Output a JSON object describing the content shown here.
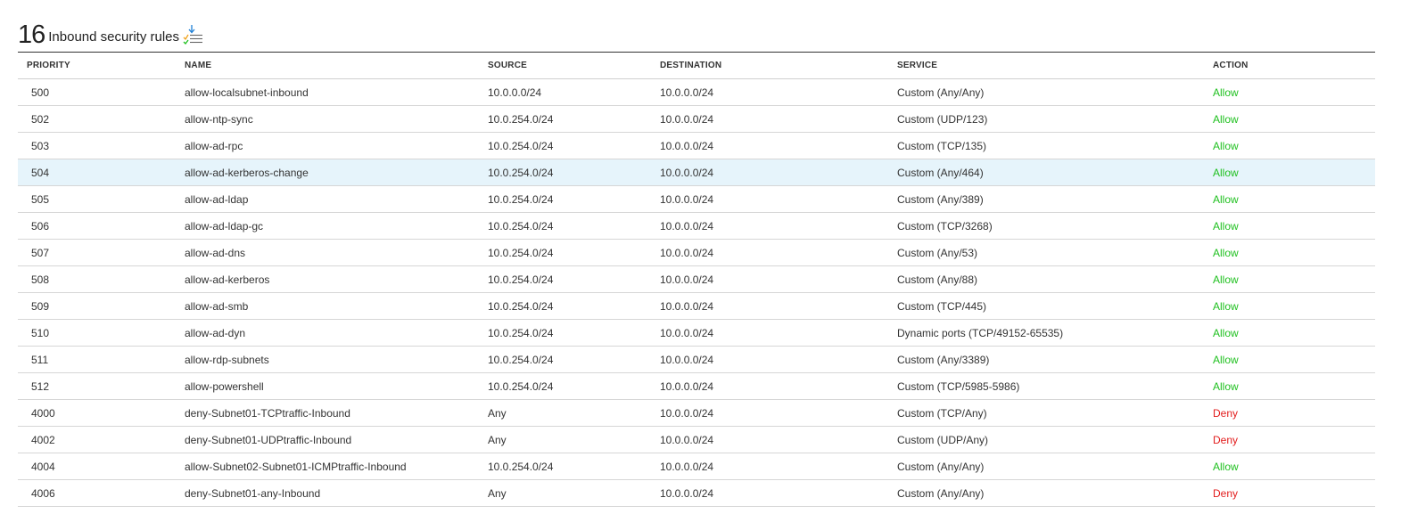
{
  "header": {
    "count": "16",
    "title": "Inbound security rules"
  },
  "columns": {
    "priority": "PRIORITY",
    "name": "NAME",
    "source": "SOURCE",
    "destination": "DESTINATION",
    "service": "SERVICE",
    "action": "ACTION"
  },
  "colors": {
    "allow": "#1fc01f",
    "deny": "#e21d1d",
    "selected_row": "#e6f4fb"
  },
  "icons": {
    "export": "download-checklist-icon"
  },
  "selected_row_index": 3,
  "rows": [
    {
      "priority": "500",
      "name": "allow-localsubnet-inbound",
      "source": "10.0.0.0/24",
      "destination": "10.0.0.0/24",
      "service": "Custom (Any/Any)",
      "action": "Allow"
    },
    {
      "priority": "502",
      "name": "allow-ntp-sync",
      "source": "10.0.254.0/24",
      "destination": "10.0.0.0/24",
      "service": "Custom (UDP/123)",
      "action": "Allow"
    },
    {
      "priority": "503",
      "name": "allow-ad-rpc",
      "source": "10.0.254.0/24",
      "destination": "10.0.0.0/24",
      "service": "Custom (TCP/135)",
      "action": "Allow"
    },
    {
      "priority": "504",
      "name": "allow-ad-kerberos-change",
      "source": "10.0.254.0/24",
      "destination": "10.0.0.0/24",
      "service": "Custom (Any/464)",
      "action": "Allow"
    },
    {
      "priority": "505",
      "name": "allow-ad-ldap",
      "source": "10.0.254.0/24",
      "destination": "10.0.0.0/24",
      "service": "Custom (Any/389)",
      "action": "Allow"
    },
    {
      "priority": "506",
      "name": "allow-ad-ldap-gc",
      "source": "10.0.254.0/24",
      "destination": "10.0.0.0/24",
      "service": "Custom (TCP/3268)",
      "action": "Allow"
    },
    {
      "priority": "507",
      "name": "allow-ad-dns",
      "source": "10.0.254.0/24",
      "destination": "10.0.0.0/24",
      "service": "Custom (Any/53)",
      "action": "Allow"
    },
    {
      "priority": "508",
      "name": "allow-ad-kerberos",
      "source": "10.0.254.0/24",
      "destination": "10.0.0.0/24",
      "service": "Custom (Any/88)",
      "action": "Allow"
    },
    {
      "priority": "509",
      "name": "allow-ad-smb",
      "source": "10.0.254.0/24",
      "destination": "10.0.0.0/24",
      "service": "Custom (TCP/445)",
      "action": "Allow"
    },
    {
      "priority": "510",
      "name": "allow-ad-dyn",
      "source": "10.0.254.0/24",
      "destination": "10.0.0.0/24",
      "service": "Dynamic ports (TCP/49152-65535)",
      "action": "Allow"
    },
    {
      "priority": "511",
      "name": "allow-rdp-subnets",
      "source": "10.0.254.0/24",
      "destination": "10.0.0.0/24",
      "service": "Custom (Any/3389)",
      "action": "Allow"
    },
    {
      "priority": "512",
      "name": "allow-powershell",
      "source": "10.0.254.0/24",
      "destination": "10.0.0.0/24",
      "service": "Custom (TCP/5985-5986)",
      "action": "Allow"
    },
    {
      "priority": "4000",
      "name": "deny-Subnet01-TCPtraffic-Inbound",
      "source": "Any",
      "destination": "10.0.0.0/24",
      "service": "Custom (TCP/Any)",
      "action": "Deny"
    },
    {
      "priority": "4002",
      "name": "deny-Subnet01-UDPtraffic-Inbound",
      "source": "Any",
      "destination": "10.0.0.0/24",
      "service": "Custom (UDP/Any)",
      "action": "Deny"
    },
    {
      "priority": "4004",
      "name": "allow-Subnet02-Subnet01-ICMPtraffic-Inbound",
      "source": "10.0.254.0/24",
      "destination": "10.0.0.0/24",
      "service": "Custom (Any/Any)",
      "action": "Allow"
    },
    {
      "priority": "4006",
      "name": "deny-Subnet01-any-Inbound",
      "source": "Any",
      "destination": "10.0.0.0/24",
      "service": "Custom (Any/Any)",
      "action": "Deny"
    }
  ]
}
